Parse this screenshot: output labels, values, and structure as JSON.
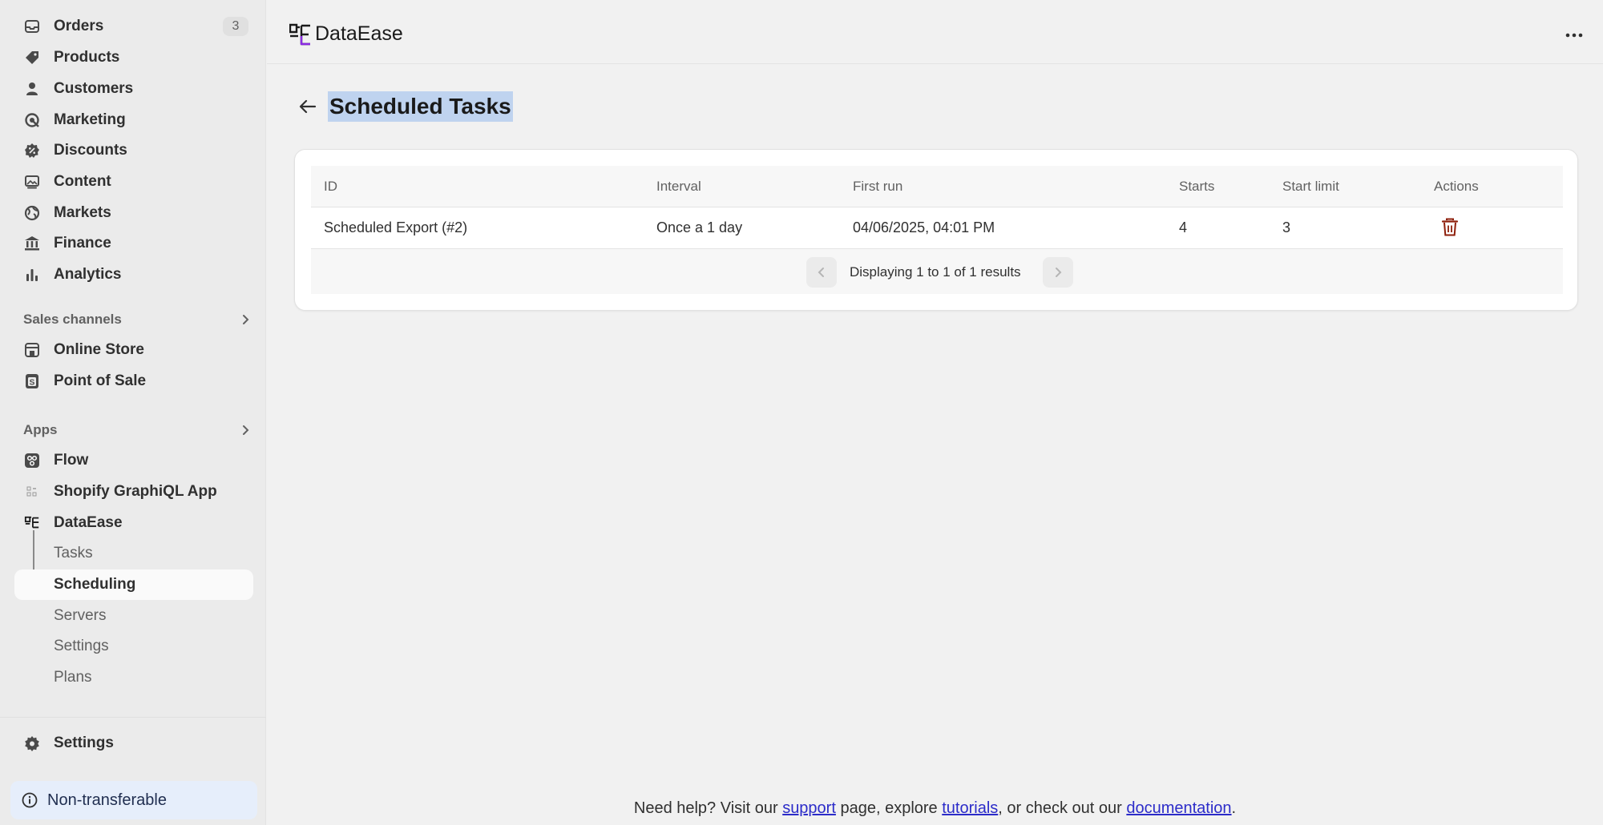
{
  "sidebar": {
    "main_items": [
      {
        "label": "Orders",
        "badge": "3",
        "icon": "orders-inbox-icon"
      },
      {
        "label": "Products",
        "icon": "tag-icon"
      },
      {
        "label": "Customers",
        "icon": "person-icon"
      },
      {
        "label": "Marketing",
        "icon": "target-icon"
      },
      {
        "label": "Discounts",
        "icon": "discount-badge-icon"
      },
      {
        "label": "Content",
        "icon": "image-icon"
      },
      {
        "label": "Markets",
        "icon": "globe-icon"
      },
      {
        "label": "Finance",
        "icon": "bank-icon"
      },
      {
        "label": "Analytics",
        "icon": "bar-chart-icon"
      }
    ],
    "sales_channels": {
      "heading": "Sales channels",
      "items": [
        {
          "label": "Online Store",
          "icon": "store-icon"
        },
        {
          "label": "Point of Sale",
          "icon": "pos-icon"
        }
      ]
    },
    "apps": {
      "heading": "Apps",
      "items": [
        {
          "label": "Flow",
          "icon": "flow-icon"
        },
        {
          "label": "Shopify GraphiQL App",
          "icon": "graphiql-icon"
        },
        {
          "label": "DataEase",
          "icon": "dataease-logo-icon"
        }
      ],
      "subitems": [
        {
          "label": "Tasks"
        },
        {
          "label": "Scheduling"
        },
        {
          "label": "Servers"
        },
        {
          "label": "Settings"
        },
        {
          "label": "Plans"
        }
      ]
    },
    "settings_label": "Settings",
    "notice_label": "Non-transferable"
  },
  "header": {
    "app_title": "DataEase",
    "page_title": "Scheduled Tasks"
  },
  "table": {
    "columns": [
      "ID",
      "Interval",
      "First run",
      "Starts",
      "Start limit",
      "Actions"
    ],
    "rows": [
      {
        "id": "Scheduled Export (#2)",
        "interval": "Once a 1 day",
        "first_run": "04/06/2025, 04:01 PM",
        "starts": "4",
        "start_limit": "3"
      }
    ],
    "pagination_text": "Displaying 1 to 1 of 1 results"
  },
  "footer": {
    "t1": "Need help? Visit our ",
    "support": "support",
    "t2": " page, explore ",
    "tutorials": "tutorials",
    "t3": ", or check out our ",
    "documentation": "documentation",
    "t4": "."
  },
  "colors": {
    "accent_purple": "#8a2be2",
    "danger": "#8e1f0b",
    "selection": "#bfd3ef",
    "link": "#2c2cc9"
  }
}
